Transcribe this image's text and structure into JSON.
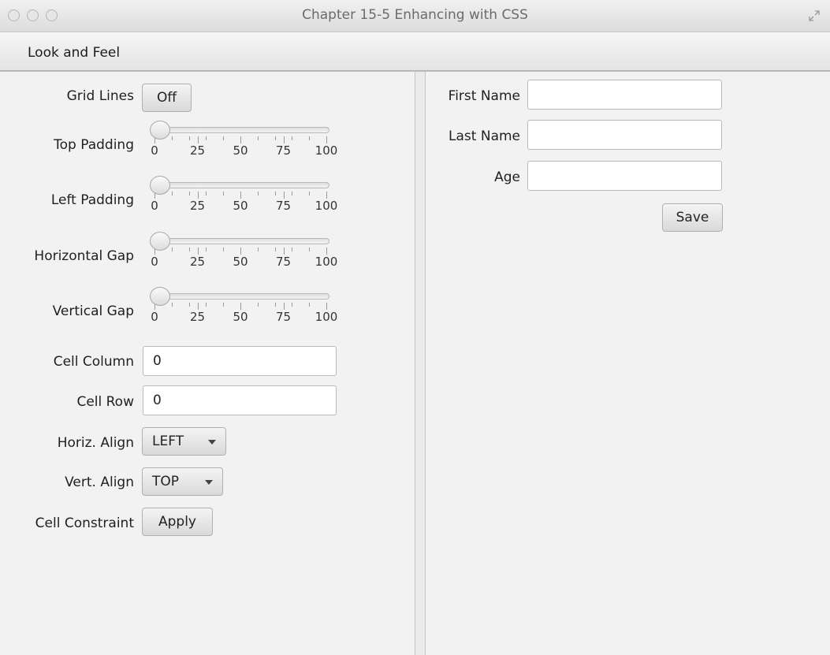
{
  "window": {
    "title": "Chapter 15-5 Enhancing with CSS"
  },
  "menubar": {
    "items": [
      {
        "label": "Look and Feel"
      }
    ]
  },
  "left": {
    "grid_lines": {
      "label": "Grid Lines",
      "button": "Off"
    },
    "sliders": [
      {
        "label": "Top Padding",
        "value": 0,
        "min": 0,
        "max": 100,
        "ticks": [
          "0",
          "25",
          "50",
          "75",
          "100"
        ]
      },
      {
        "label": "Left Padding",
        "value": 0,
        "min": 0,
        "max": 100,
        "ticks": [
          "0",
          "25",
          "50",
          "75",
          "100"
        ]
      },
      {
        "label": "Horizontal Gap",
        "value": 0,
        "min": 0,
        "max": 100,
        "ticks": [
          "0",
          "25",
          "50",
          "75",
          "100"
        ]
      },
      {
        "label": "Vertical Gap",
        "value": 0,
        "min": 0,
        "max": 100,
        "ticks": [
          "0",
          "25",
          "50",
          "75",
          "100"
        ]
      }
    ],
    "cell_column": {
      "label": "Cell Column",
      "value": "0"
    },
    "cell_row": {
      "label": "Cell Row",
      "value": "0"
    },
    "horiz_align": {
      "label": "Horiz. Align",
      "selected": "LEFT"
    },
    "vert_align": {
      "label": "Vert. Align",
      "selected": "TOP"
    },
    "cell_constraint": {
      "label": "Cell Constraint",
      "button": "Apply"
    }
  },
  "form": {
    "first_name": {
      "label": "First Name",
      "value": ""
    },
    "last_name": {
      "label": "Last Name",
      "value": ""
    },
    "age": {
      "label": "Age",
      "value": ""
    },
    "save": "Save"
  },
  "icons": {
    "window_close": "window-close-icon",
    "window_minimize": "window-minimize-icon",
    "window_zoom": "window-zoom-icon",
    "fullscreen": "fullscreen-icon",
    "dropdown": "chevron-down-icon"
  }
}
